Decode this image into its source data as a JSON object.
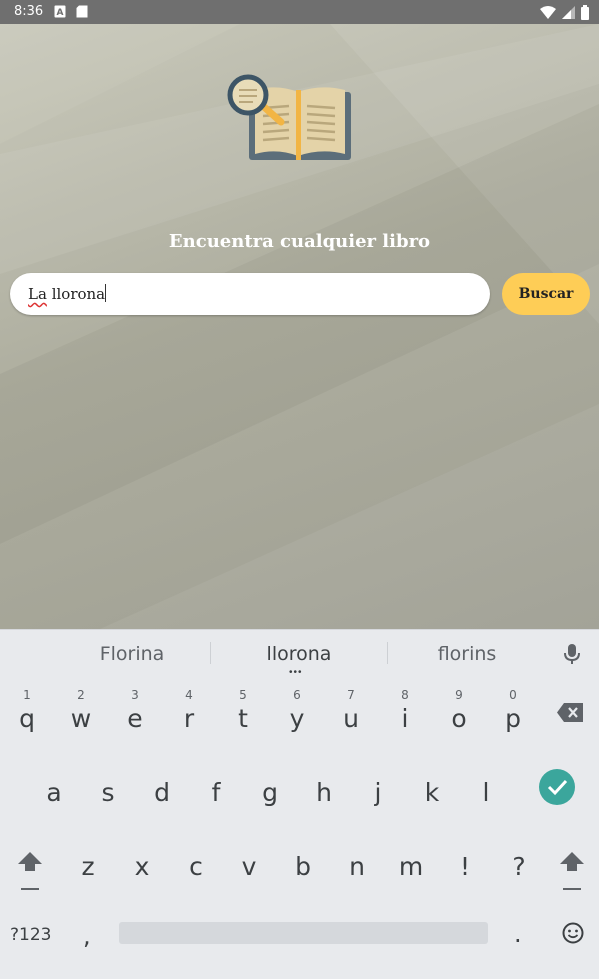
{
  "status_bar": {
    "time": "8:36",
    "icons": [
      "notification-a-icon",
      "sd-card-icon",
      "wifi-icon",
      "signal-icon",
      "battery-icon"
    ]
  },
  "app": {
    "title": "Encuentra cualquier libro",
    "search": {
      "value_word1": "La",
      "value_word2": "llorona",
      "placeholder": ""
    },
    "search_button_label": "Buscar",
    "colors": {
      "button": "#fecd56",
      "logo_book": "#e4d3a8",
      "logo_accent": "#f2b544"
    }
  },
  "keyboard": {
    "suggestions": [
      "Florina",
      "llorona",
      "florins"
    ],
    "row1": [
      {
        "key": "q",
        "hint": "1"
      },
      {
        "key": "w",
        "hint": "2"
      },
      {
        "key": "e",
        "hint": "3"
      },
      {
        "key": "r",
        "hint": "4"
      },
      {
        "key": "t",
        "hint": "5"
      },
      {
        "key": "y",
        "hint": "6"
      },
      {
        "key": "u",
        "hint": "7"
      },
      {
        "key": "i",
        "hint": "8"
      },
      {
        "key": "o",
        "hint": "9"
      },
      {
        "key": "p",
        "hint": "0"
      }
    ],
    "row2": [
      "a",
      "s",
      "d",
      "f",
      "g",
      "h",
      "j",
      "k",
      "l"
    ],
    "row3": [
      "z",
      "x",
      "c",
      "v",
      "b",
      "n",
      "m",
      "!",
      "?"
    ],
    "symbols_label": "?123",
    "comma": ",",
    "period": ".",
    "enter_color": "#3ba69c"
  }
}
